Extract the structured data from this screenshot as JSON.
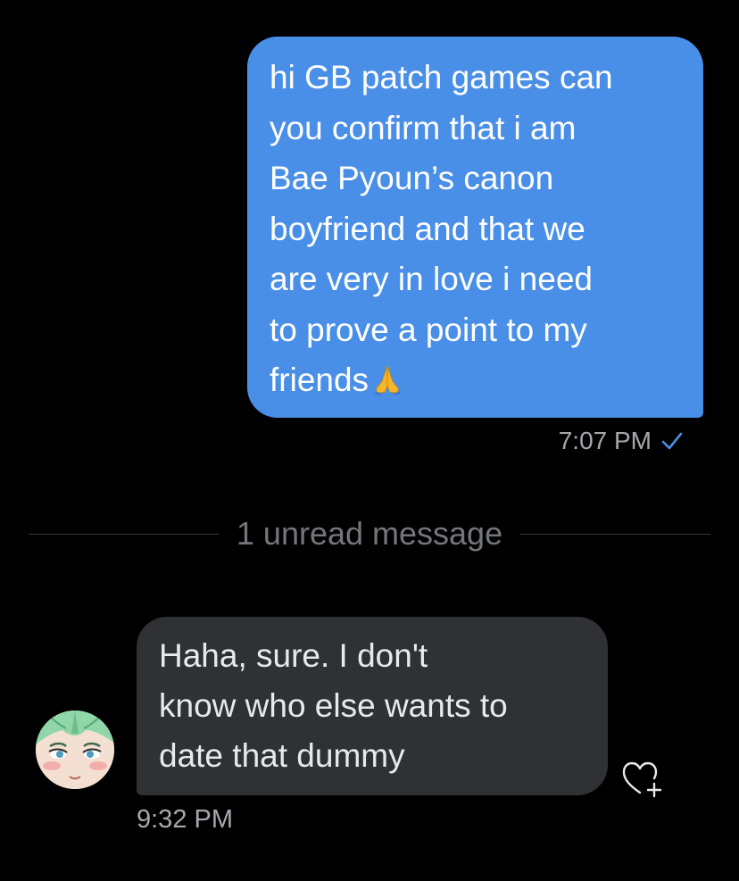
{
  "conversation": {
    "sent_message": {
      "text": "hi GB patch games can\nyou confirm that i am\nBae Pyoun’s canon\nboyfriend and that we\nare very in love i need\nto prove a point to my\nfriends",
      "emoji": "folded-hands",
      "time": "7:07 PM",
      "status_icon": "check-icon",
      "bubble_color": "#4a8fe7"
    },
    "unread_divider": {
      "label": "1 unread message"
    },
    "received_message": {
      "text": "Haha, sure. I don't\nknow who else wants to\ndate that dummy",
      "time": "9:32 PM",
      "avatar": "avatar",
      "reaction_icon": "heart-plus-icon",
      "bubble_color": "#2f3135"
    }
  },
  "colors": {
    "background": "#000000",
    "accent": "#4a8fe7",
    "meta_text": "#a5a9ae"
  }
}
